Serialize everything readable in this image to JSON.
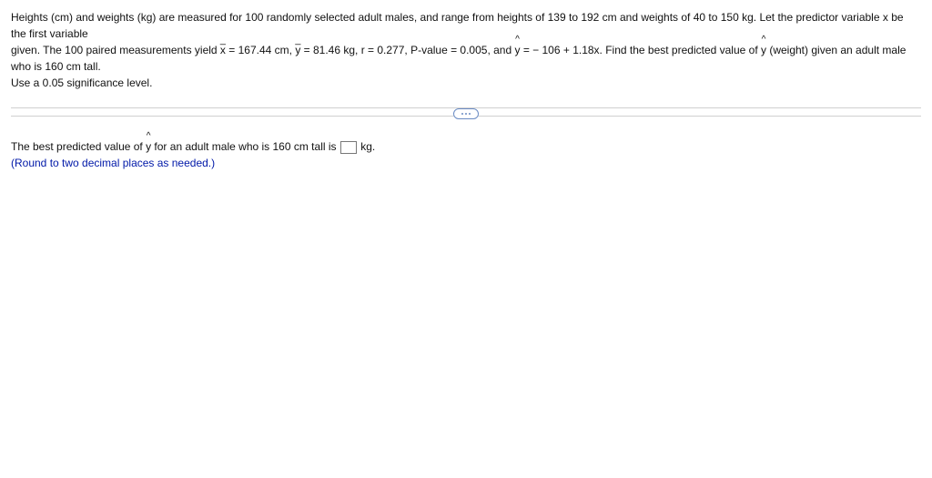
{
  "problem": {
    "line1": "Heights (cm) and weights (kg) are measured for 100 randomly selected adult males, and range from heights of 139 to 192 cm and weights of 40 to 150 kg. Let the predictor variable x be the first variable",
    "line2a": "given. The 100 paired measurements yield ",
    "xbar_sym": "x",
    "xbar_val": " = 167.44 cm, ",
    "ybar_sym": "y",
    "ybar_val": " = 81.46 kg, r = 0.277, P-value = 0.005, and ",
    "yhat_sym": "y",
    "eq_after": " = − 106 + 1.18x. Find the best predicted value of ",
    "yhat_sym2": "y",
    "line2end": " (weight) given an adult male who is 160 cm tall.",
    "line3": "Use a 0.05 significance level."
  },
  "answer": {
    "pre": "The best predicted value of ",
    "yhat_sym": "y",
    "mid": " for an adult male who is 160 cm tall is ",
    "unit": " kg.",
    "hint": "(Round to two decimal places as needed.)"
  }
}
